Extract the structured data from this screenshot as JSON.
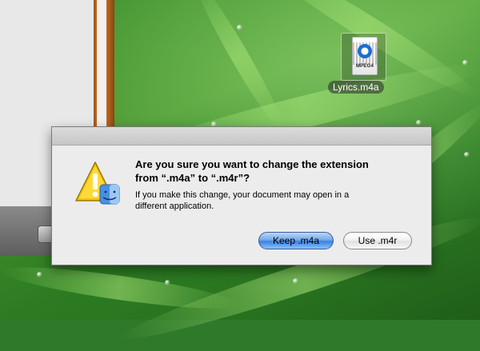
{
  "desktop": {
    "file_icon": {
      "name": "Lyrics.m4a",
      "badge": "MPEG4",
      "icon": "quicktime-mpeg4-file-icon"
    }
  },
  "dialog": {
    "title_lines": [
      "Are you sure you want to change the extension",
      "from “.m4a” to “.m4r”?"
    ],
    "message_lines": [
      "If you make this change, your document may open in a",
      "different application."
    ],
    "icon": "finder-caution-icon",
    "buttons": {
      "keep": "Keep .m4a",
      "use": "Use .m4r"
    }
  },
  "colors": {
    "default_button": "#3c82df",
    "warning_yellow": "#f5c400",
    "wallpaper_green": "#3d8f2e"
  }
}
